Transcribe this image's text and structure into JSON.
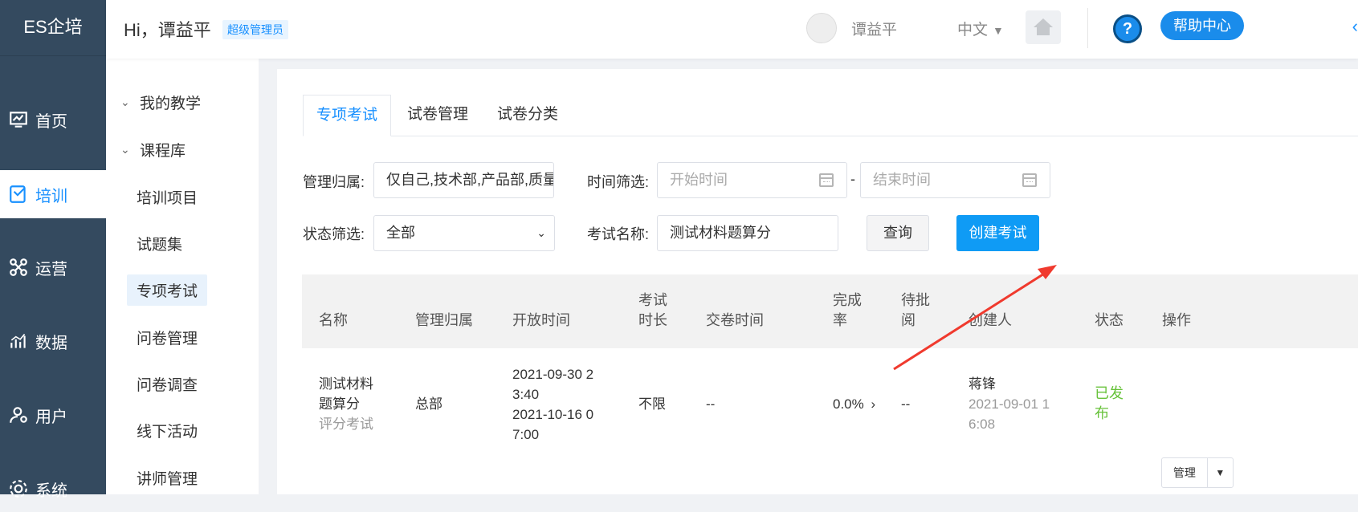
{
  "app": {
    "logo": "ES企培"
  },
  "nav": {
    "items": [
      {
        "label": "首页",
        "icon": "dashboard-icon"
      },
      {
        "label": "培训",
        "icon": "training-icon",
        "active": true
      },
      {
        "label": "运营",
        "icon": "operations-icon"
      },
      {
        "label": "数据",
        "icon": "chart-icon"
      },
      {
        "label": "用户",
        "icon": "user-icon"
      },
      {
        "label": "系统",
        "icon": "gear-icon"
      }
    ]
  },
  "subnav": {
    "groups": [
      "我的教学",
      "课程库"
    ],
    "items": [
      "培训项目",
      "试题集",
      "专项考试",
      "问卷管理",
      "问卷调查",
      "线下活动",
      "讲师管理"
    ],
    "active": "专项考试"
  },
  "header": {
    "greeting": "Hi，谭益平",
    "role": "超级管理员",
    "user_name": "谭益平",
    "language": "中文",
    "help": "帮助中心",
    "help_mark": "?"
  },
  "tabs": [
    "专项考试",
    "试卷管理",
    "试卷分类"
  ],
  "filters": {
    "owner_label": "管理归属:",
    "owner_value": "仅自己,技术部,产品部,质量部",
    "time_label": "时间筛选:",
    "start_placeholder": "开始时间",
    "end_placeholder": "结束时间",
    "dash": "-",
    "status_label": "状态筛选:",
    "status_value": "全部",
    "name_label": "考试名称:",
    "name_value": "测试材料题算分",
    "query_button": "查询",
    "create_button": "创建考试"
  },
  "table": {
    "headers": {
      "name": "名称",
      "owner": "管理归属",
      "open_time": "开放时间",
      "duration_1": "考试",
      "duration_2": "时长",
      "submit_time": "交卷时间",
      "completion_1": "完成",
      "completion_2": "率",
      "pending_1": "待批",
      "pending_2": "阅",
      "creator": "创建人",
      "status": "状态",
      "actions": "操作"
    },
    "rows": [
      {
        "name_1": "测试材料",
        "name_2": "题算分",
        "type": "评分考试",
        "owner": "总部",
        "open_1": "2021-09-30 2",
        "open_2": "3:40",
        "open_3": "2021-10-16 0",
        "open_4": "7:00",
        "duration": "不限",
        "submit_time": "--",
        "completion": "0.0%",
        "pending": "--",
        "creator": "蒋锋",
        "created_1": "2021-09-01 1",
        "created_2": "6:08",
        "status_1": "已发",
        "status_2": "布",
        "manage": "管理"
      }
    ]
  },
  "colors": {
    "primary": "#1890ff",
    "button_blue": "#0f9bf5",
    "sidebar": "#344a5f",
    "published": "#67c23a",
    "annotation_arrow": "#f03a2e"
  }
}
